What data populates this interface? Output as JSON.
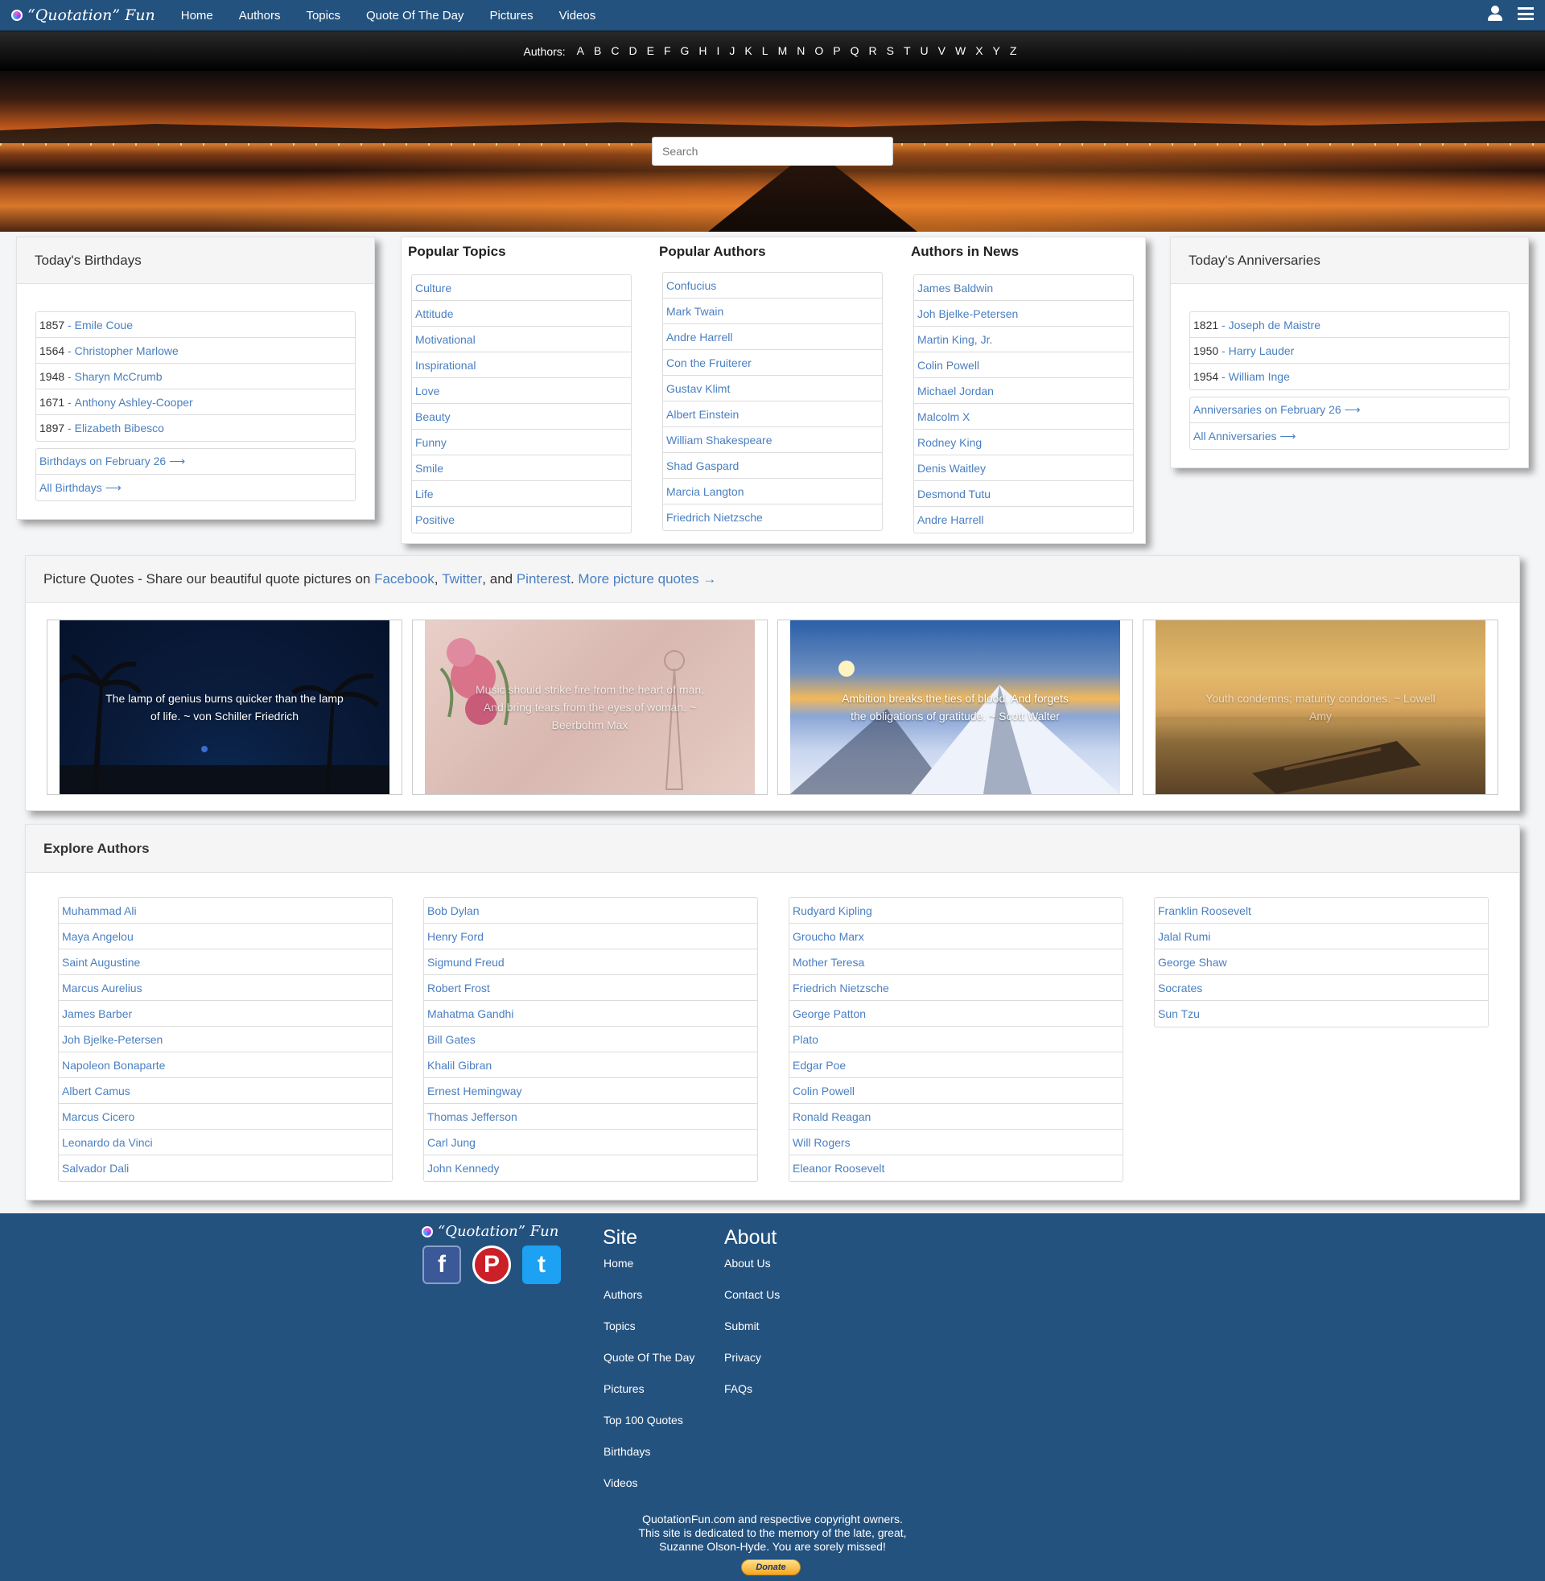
{
  "nav": {
    "brand": "“Quotation” Fun",
    "links": [
      "Home",
      "Authors",
      "Topics",
      "Quote Of The Day",
      "Pictures",
      "Videos"
    ]
  },
  "alphabet": {
    "label": "Authors:",
    "letters": [
      "A",
      "B",
      "C",
      "D",
      "E",
      "F",
      "G",
      "H",
      "I",
      "J",
      "K",
      "L",
      "M",
      "N",
      "O",
      "P",
      "Q",
      "R",
      "S",
      "T",
      "U",
      "V",
      "W",
      "X",
      "Y",
      "Z"
    ]
  },
  "search": {
    "placeholder": "Search"
  },
  "birthdays": {
    "title": "Today's Birthdays",
    "items": [
      {
        "year": "1857",
        "name": "Emile Coue"
      },
      {
        "year": "1564",
        "name": "Christopher Marlowe"
      },
      {
        "year": "1948",
        "name": "Sharyn McCrumb"
      },
      {
        "year": "1671",
        "name": "Anthony Ashley-Cooper"
      },
      {
        "year": "1897",
        "name": "Elizabeth Bibesco"
      }
    ],
    "links": [
      "Birthdays on February 26 ⟶",
      "All Birthdays ⟶"
    ]
  },
  "popular_topics": {
    "title": "Popular Topics",
    "items": [
      "Culture",
      "Attitude",
      "Motivational",
      "Inspirational",
      "Love",
      "Beauty",
      "Funny",
      "Smile",
      "Life",
      "Positive"
    ]
  },
  "popular_authors": {
    "title": "Popular Authors",
    "items": [
      "Confucius",
      "Mark Twain",
      "Andre Harrell",
      "Con the Fruiterer",
      "Gustav Klimt",
      "Albert Einstein",
      "William Shakespeare",
      "Shad Gaspard",
      "Marcia Langton",
      "Friedrich Nietzsche"
    ]
  },
  "authors_in_news": {
    "title": "Authors in News",
    "items": [
      "James Baldwin",
      "Joh Bjelke-Petersen",
      "Martin King, Jr.",
      "Colin Powell",
      "Michael Jordan",
      "Malcolm X",
      "Rodney King",
      "Denis Waitley",
      "Desmond Tutu",
      "Andre Harrell"
    ]
  },
  "anniversaries": {
    "title": "Today's Anniversaries",
    "items": [
      {
        "year": "1821",
        "name": "Joseph de Maistre"
      },
      {
        "year": "1950",
        "name": "Harry Lauder"
      },
      {
        "year": "1954",
        "name": "William Inge"
      }
    ],
    "links": [
      "Anniversaries on February 26 ⟶",
      "All Anniversaries ⟶"
    ]
  },
  "picture_quotes": {
    "lead": "Picture Quotes - Share our beautiful quote pictures on",
    "facebook": "Facebook",
    "comma": ",",
    "twitter": "Twitter",
    "and": ", and",
    "pinterest": "Pinterest",
    "period": ".",
    "more": "More picture quotes →",
    "quotes": [
      "The lamp of genius burns quicker than the lamp of life. ~ von Schiller Friedrich",
      "Music should strike fire from the heart of man, And bring tears from the eyes of woman. ~ Beerbohm Max",
      "Ambition breaks the ties of blood, And forgets the obligations of gratitude. ~ Scott Walter",
      "Youth condemns; maturity condones. ~ Lowell Amy"
    ]
  },
  "explore": {
    "title": "Explore Authors",
    "columns": [
      [
        "Muhammad Ali",
        "Maya Angelou",
        "Saint Augustine",
        "Marcus Aurelius",
        "James Barber",
        "Joh Bjelke-Petersen",
        "Napoleon Bonaparte",
        "Albert Camus",
        "Marcus Cicero",
        "Leonardo da Vinci",
        "Salvador Dali"
      ],
      [
        "Bob Dylan",
        "Henry Ford",
        "Sigmund Freud",
        "Robert Frost",
        "Mahatma Gandhi",
        "Bill Gates",
        "Khalil Gibran",
        "Ernest Hemingway",
        "Thomas Jefferson",
        "Carl Jung",
        "John Kennedy"
      ],
      [
        "Rudyard Kipling",
        "Groucho Marx",
        "Mother Teresa",
        "Friedrich Nietzsche",
        "George Patton",
        "Plato",
        "Edgar Poe",
        "Colin Powell",
        "Ronald Reagan",
        "Will Rogers",
        "Eleanor Roosevelt"
      ],
      [
        "Franklin Roosevelt",
        "Jalal Rumi",
        "George Shaw",
        "Socrates",
        "Sun Tzu"
      ]
    ]
  },
  "footer": {
    "brand": "“Quotation” Fun",
    "social": [
      "f",
      "P",
      "t"
    ],
    "site_title": "Site",
    "site_links": [
      "Home",
      "Authors",
      "Topics",
      "Quote Of The Day",
      "Pictures",
      "Top 100 Quotes",
      "Birthdays",
      "Videos"
    ],
    "about_title": "About",
    "about_links": [
      "About Us",
      "Contact Us",
      "Submit",
      "Privacy",
      "FAQs"
    ],
    "copyright": [
      "QuotationFun.com and respective copyright owners.",
      "This site is dedicated to the memory of the late, great,",
      "Suzanne Olson-Hyde. You are sorely missed!"
    ],
    "donate": "Donate"
  },
  "colors": {
    "nav_bg": "#24527f",
    "link": "#4a7fc1",
    "facebook": "#3b5998",
    "pinterest": "#cb2027",
    "twitter": "#1da1f2"
  }
}
